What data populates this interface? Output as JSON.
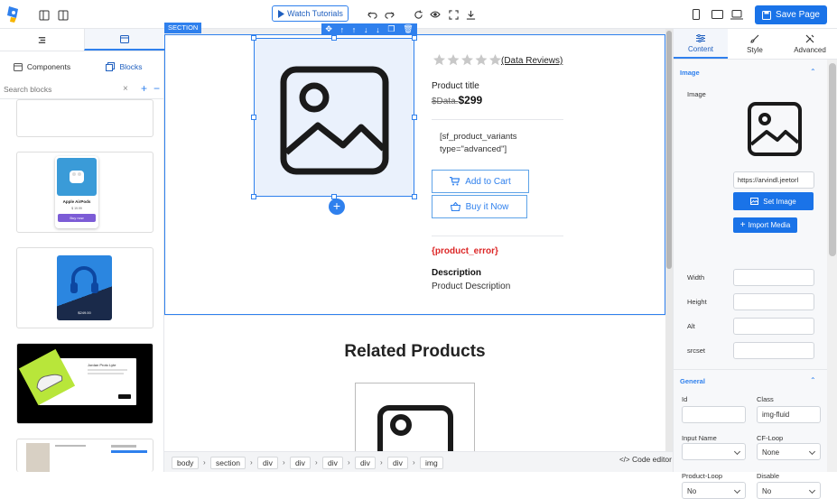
{
  "topbar": {
    "watch_label": "Watch Tutorials",
    "save_label": "Save Page"
  },
  "left_panel": {
    "tabs": [
      "Components",
      "Blocks"
    ],
    "search_placeholder": "Search blocks",
    "thumb2": {
      "title": "Apple AirPods",
      "price": "$ 19.99",
      "button": "Buy now"
    },
    "thumb3": {
      "price": "$249.00"
    },
    "thumb4": {
      "title": "Jordan Proto Lyte"
    }
  },
  "canvas": {
    "section_badge": "SECTION",
    "rating_link": "(Data Reviews)",
    "product_title": "Product title",
    "old_price": "$Data.",
    "price": "$299",
    "variants_code": "[sf_product_variants type=\"advanced\"]",
    "add_to_cart": "Add to Cart",
    "buy_now": "Buy it Now",
    "error": "{product_error}",
    "description_heading": "Description",
    "description_text": "Product Description",
    "related_heading": "Related Products"
  },
  "breadcrumb": [
    "body",
    "section",
    "div",
    "div",
    "div",
    "div",
    "div",
    "img"
  ],
  "code_editor_label": "Code editor",
  "right_panel": {
    "tabs": [
      "Content",
      "Style",
      "Advanced"
    ],
    "image_section": "Image",
    "image_label": "Image",
    "image_url": "https://arvindl.jeetorl",
    "set_image": "Set Image",
    "import_media": "Import Media",
    "width": "Width",
    "height": "Height",
    "alt": "Alt",
    "srcset": "srcset",
    "general_section": "General",
    "id_label": "Id",
    "class_label": "Class",
    "class_value": "img-fluid",
    "input_name_label": "Input Name",
    "cf_loop_label": "CF-Loop",
    "cf_loop_value": "None",
    "product_loop_label": "Product-Loop",
    "product_loop_value": "No",
    "disable_label": "Disable",
    "disable_value": "No"
  },
  "colors": {
    "accent": "#2f80ed",
    "primary_button": "#1a73e8",
    "error": "#dc2626"
  }
}
